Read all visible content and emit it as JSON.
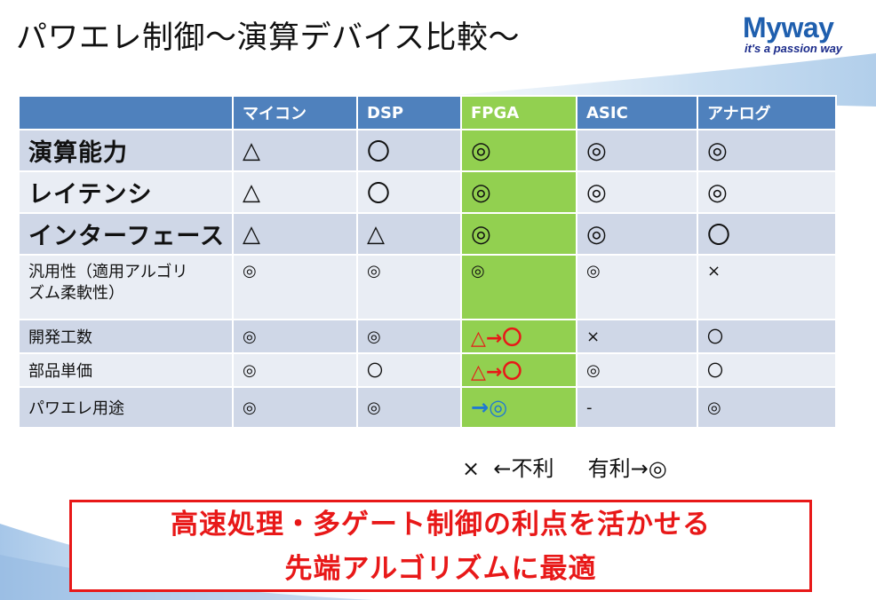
{
  "slide": {
    "title": "パワエレ制御～演算デバイス比較～",
    "logo": {
      "name": "Myway",
      "tagline": "it's a passion way"
    }
  },
  "table": {
    "columns": [
      "",
      "マイコン",
      "DSP",
      "FPGA",
      "ASIC",
      "アナログ"
    ],
    "rows": [
      {
        "label": "演算能力",
        "cells": [
          "△",
          "〇",
          "◎",
          "◎",
          "◎"
        ]
      },
      {
        "label": "レイテンシ",
        "cells": [
          "△",
          "〇",
          "◎",
          "◎",
          "◎"
        ]
      },
      {
        "label": "インターフェース",
        "cells": [
          "△",
          "△",
          "◎",
          "◎",
          "〇"
        ]
      },
      {
        "label_line1": "汎用性（適用アルゴリ",
        "label_line2": "ズム柔軟性）",
        "cells": [
          "◎",
          "◎",
          "◎",
          "◎",
          "×"
        ]
      },
      {
        "label": "開発工数",
        "cells": [
          "◎",
          "◎",
          "△→〇",
          "×",
          "〇"
        ]
      },
      {
        "label": "部品単価",
        "cells": [
          "◎",
          "〇",
          "△→〇",
          "◎",
          "〇"
        ]
      },
      {
        "label": "パワエレ用途",
        "cells": [
          "◎",
          "◎",
          "→◎",
          "-",
          "◎"
        ]
      }
    ]
  },
  "legend": "×  ←不利     有利→◎",
  "callout": {
    "line1": "高速処理・多ゲート制御の利点を活かせる",
    "line2": "先端アルゴリズムに最適"
  },
  "colors": {
    "header_blue": "#4f81bd",
    "highlight_green": "#92d050",
    "row_dark": "#cfd7e7",
    "row_light": "#e9edf4",
    "emphasis_red": "#e81818",
    "emphasis_blue": "#1f78d4",
    "logo_blue": "#1f5fae"
  }
}
